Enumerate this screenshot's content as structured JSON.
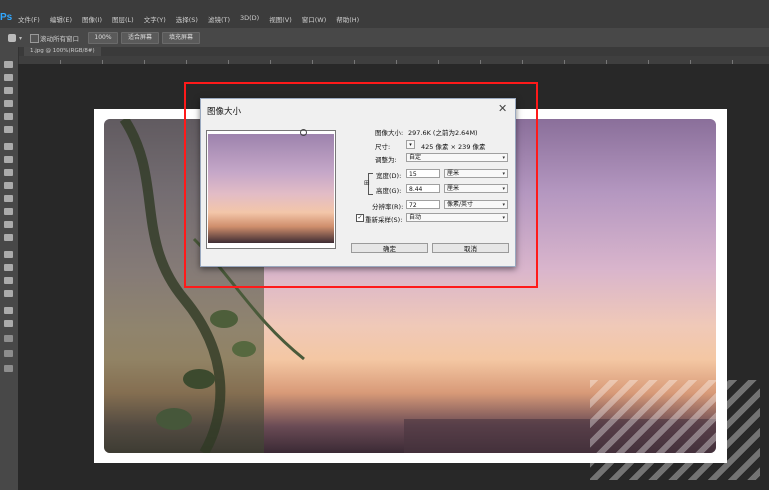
{
  "app": {
    "logo": "Ps"
  },
  "menu": [
    "文件(F)",
    "编辑(E)",
    "图像(I)",
    "图层(L)",
    "文字(Y)",
    "选择(S)",
    "滤镜(T)",
    "3D(D)",
    "视图(V)",
    "窗口(W)",
    "帮助(H)"
  ],
  "options_bar": {
    "scroll_all_label": "滚动所有窗口",
    "zoom_100_label": "100%",
    "fit_screen_label": "适合屏幕",
    "fill_screen_label": "填充屏幕"
  },
  "document_tab": {
    "label": "1.jpg @ 100%(RGB/8#)"
  },
  "tools": [
    "move",
    "marquee",
    "lasso",
    "quick-select",
    "crop",
    "eyedropper",
    "healing",
    "brush",
    "clone-stamp",
    "history-brush",
    "eraser",
    "gradient",
    "blur",
    "dodge",
    "pen",
    "type",
    "path-select",
    "shape",
    "hand",
    "zoom",
    "colors",
    "quick-mask",
    "screen-mode"
  ],
  "dialog": {
    "title": "图像大小",
    "image_size_label": "图像大小:",
    "image_size_value": "297.6K (之前为2.64M)",
    "dimensions_label": "尺寸:",
    "dimensions_value": "425 像素 × 239 像素",
    "fit_to_label": "调整为:",
    "fit_to_value": "自定",
    "width_label": "宽度(D):",
    "width_value": "15",
    "width_unit": "厘米",
    "height_label": "高度(G):",
    "height_value": "8.44",
    "height_unit": "厘米",
    "resolution_label": "分辨率(R):",
    "resolution_value": "72",
    "resolution_unit": "像素/英寸",
    "resample_label": "重新采样(S):",
    "resample_checked": true,
    "resample_value": "自动",
    "ok_label": "确定",
    "cancel_label": "取消"
  },
  "highlight_color": "#ff1a1a",
  "accent_color": "#31a8ff"
}
